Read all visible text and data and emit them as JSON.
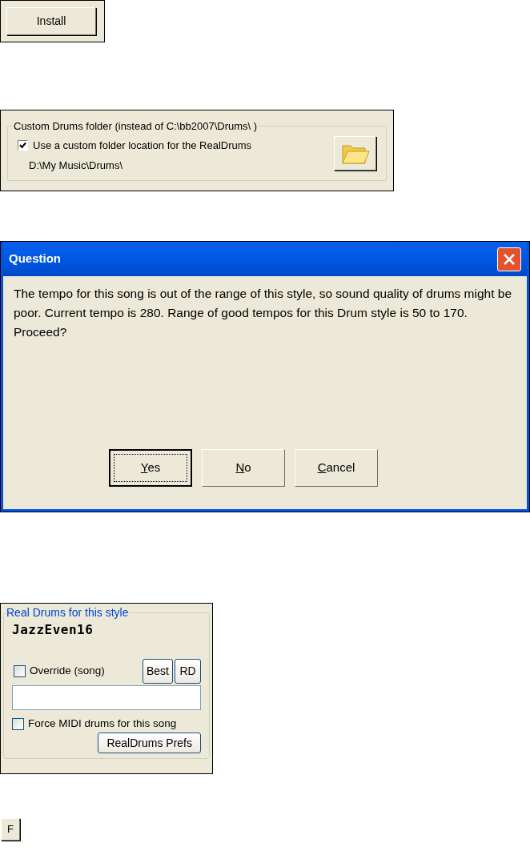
{
  "install_button": {
    "label": "Install"
  },
  "custom_drums": {
    "legend": "Custom Drums folder (instead of C:\\bb2007\\Drums\\ )",
    "checkbox": {
      "label": "Use a custom folder location for the RealDrums",
      "checked": true
    },
    "path": "D:\\My Music\\Drums\\"
  },
  "dialog": {
    "title": "Question",
    "message": "The tempo for this song is out of the range of this style, so sound quality of drums might be poor. Current tempo is 280. Range of good tempos for this Drum style is 50 to 170. Proceed?",
    "buttons": [
      {
        "label": "Yes",
        "selected": true
      },
      {
        "label": "No",
        "selected": false
      },
      {
        "label": "Cancel",
        "selected": false
      }
    ]
  },
  "real_drums": {
    "legend": "Real Drums for this style",
    "style_name": "JazzEven16",
    "override": {
      "label": "Override (song)",
      "checked": false
    },
    "buttons": [
      "Best",
      "RD"
    ],
    "force_midi": {
      "label": "Force MIDI drums for this song",
      "checked": false
    },
    "prefs_button": "RealDrums Prefs"
  },
  "key": {
    "label": "F"
  }
}
